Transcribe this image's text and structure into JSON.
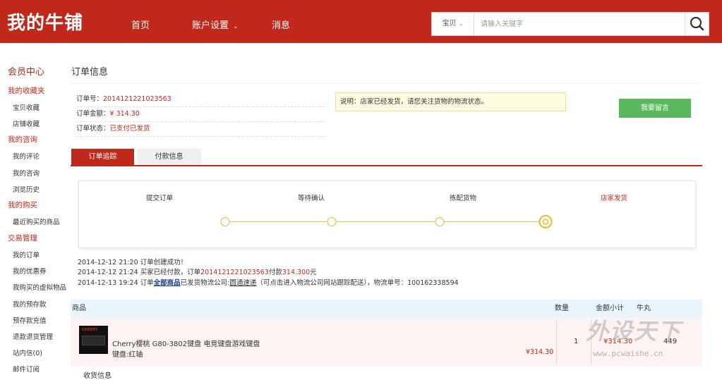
{
  "header": {
    "logo": "我的牛铺",
    "nav": {
      "home": "首页",
      "account": "账户设置",
      "messages": "消息"
    },
    "search": {
      "type_label": "宝贝",
      "placeholder": "请输入关键字"
    }
  },
  "sidebar": {
    "title": "会员中心",
    "sections": [
      {
        "label": "我的收藏夹",
        "items": [
          "宝贝收藏",
          "店铺收藏"
        ]
      },
      {
        "label": "我的咨询",
        "items": [
          "我的评论",
          "我的咨询",
          "浏览历史"
        ]
      },
      {
        "label": "我的购买",
        "items": [
          "最近购买的商品"
        ]
      },
      {
        "label": "交易管理",
        "items": [
          "我的订单",
          "我的优惠券",
          "我购买的虚拟物品",
          "我的预存款",
          "预存款充值",
          "退款退货管理",
          "站内信(0)",
          "邮件订阅"
        ]
      }
    ]
  },
  "order": {
    "page_title": "订单信息",
    "number_label": "订单号：",
    "number": "2014121221023563",
    "amount_label": "订单金额：",
    "amount": "¥ 314.30",
    "status_label": "订单状态：",
    "status": "已支付已发货",
    "notice": "说明：店家已经发货，请您关注货物的物流状态。",
    "message_button": "我要留言"
  },
  "tabs": {
    "tracking": "订单追踪",
    "payment": "付款信息"
  },
  "tracking": {
    "steps": [
      "提交订单",
      "等待确认",
      "拣配货物",
      "店家发货"
    ],
    "logs": {
      "l1": "2014-12-12 21:20  订单创建成功！",
      "l2_prefix": "2014-12-12 21:24  买家已经付款，订单",
      "l2_order": "2014121221023563",
      "l2_mid": "付款",
      "l2_amount": "314.300",
      "l2_suffix": "元",
      "l3_prefix": "2014-12-13 19:24  订单",
      "l3_link": "全部商品",
      "l3_mid": "已发货物流公司:",
      "l3_company": "圆通速递",
      "l3_suffix": "（可点击进入物流公司网站跟踪配送），物流单号：100162338594"
    }
  },
  "table": {
    "headers": {
      "product": "商品",
      "qty": "数量",
      "subtotal": "金额小计",
      "niuwan": "牛丸"
    },
    "row": {
      "image_brand": "CHERRY",
      "name": "Cherry樱桃 G80-3802键盘 电竞键盘游戏键盘",
      "spec": "键盘:红轴",
      "price": "¥314.30",
      "qty": "1",
      "subtotal": "¥314.30",
      "niuwan": "449"
    },
    "receiving_label": "收货信息"
  },
  "watermark": {
    "text": "外设天下",
    "url": "www.pcwaishe.cn"
  },
  "colors": {
    "brand": "#c0281c",
    "button": "#59b85b",
    "track": "#e8b632"
  }
}
